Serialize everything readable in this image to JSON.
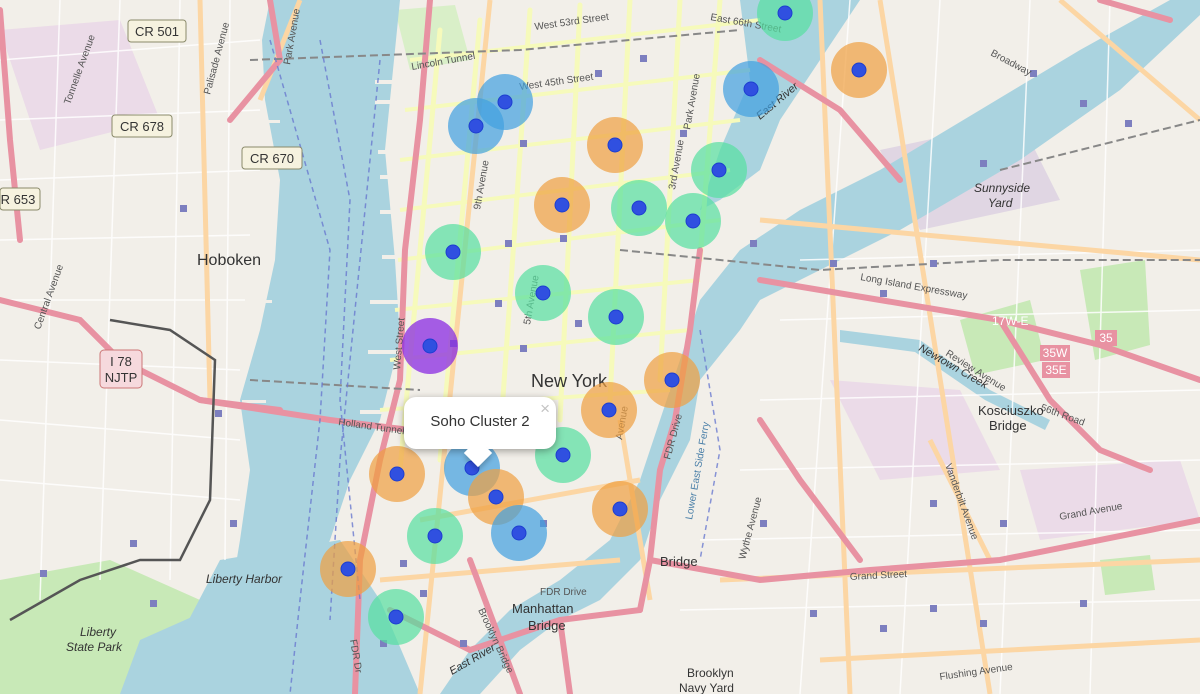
{
  "map": {
    "colors": {
      "land": "#f2efe9",
      "water": "#aad3df",
      "park": "#c8e9b7",
      "major_road": "#e892a2",
      "secondary_road": "#fcd6a4",
      "yellow_road": "#f6fabb",
      "cluster_purple": "#8a2be2",
      "cluster_blue": "#40a0e0",
      "cluster_green": "#56e0a0",
      "cluster_orange": "#f0a040",
      "center_dot": "#3050e0"
    },
    "labels": {
      "hoboken": "Hoboken",
      "new_york": "New York",
      "liberty_state_park": "Liberty\nState Park",
      "sunnyside_yard": "Sunnyside\nYard",
      "kosciuszko_bridge": "Kosciuszko\nBridge",
      "manhattan_bridge": "Manhattan\nBridge",
      "williamsburg_bridge": "Bridge",
      "brooklyn_navy_yard": "Brooklyn\nNavy Yard",
      "liberty_harbor": "Liberty Harbor",
      "east_river": "East River",
      "newtown_creek": "Newtown Creek"
    },
    "shields": {
      "cr501": "CR 501",
      "cr678": "CR 678",
      "cr670": "CR 670",
      "cr653": "R 653",
      "i78": "I 78\nNJTP",
      "r35w": "35W",
      "r35e": "35E",
      "r35": "35",
      "r17we": "17W-E"
    },
    "streets": {
      "broadway": "Broadway",
      "w53": "West 53rd Street",
      "w45": "West 45th Street",
      "e66": "East 66th Street",
      "lincoln": "Lincoln Tunnel",
      "holland": "Holland Tunnel",
      "lie": "Long Island Expressway",
      "fdr": "FDR Drive",
      "grand_ave": "Grand Avenue",
      "grand_st": "Grand Street",
      "flushing": "Flushing Avenue",
      "wythe": "Wythe Avenue",
      "vanderbilt": "Vanderbilt Avenue",
      "review": "Review Avenue",
      "e56": "56th Road",
      "palisade": "Palisade Avenue",
      "tonnelle": "Tonnelle Avenue",
      "central": "Central Avenue",
      "park_ave_nj": "Park Avenue",
      "third_ave": "3rd Avenue",
      "fifth_ave": "5th Avenue",
      "ninth_ave": "9th Avenue",
      "west_st": "West Street",
      "ninth_ave2": "Avenue",
      "park_ave": "Park Avenue",
      "lower_east_side": "Lower East Side Ferry",
      "brooklyn_bridge": "Brooklyn Bridge",
      "fdr_dr": "FDR Dr"
    },
    "clusters": [
      {
        "id": "c1",
        "color": "green"
      },
      {
        "id": "c2",
        "color": "orange"
      },
      {
        "id": "c3",
        "color": "blue"
      },
      {
        "id": "c4",
        "color": "blue"
      },
      {
        "id": "c5",
        "color": "blue"
      },
      {
        "id": "c6",
        "color": "orange"
      },
      {
        "id": "c7",
        "color": "green"
      },
      {
        "id": "c8",
        "color": "orange"
      },
      {
        "id": "c9",
        "color": "green"
      },
      {
        "id": "c10",
        "color": "green"
      },
      {
        "id": "c11",
        "color": "green"
      },
      {
        "id": "c12",
        "color": "green"
      },
      {
        "id": "c13",
        "color": "green"
      },
      {
        "id": "c14",
        "color": "purple"
      },
      {
        "id": "c15",
        "color": "orange"
      },
      {
        "id": "c16",
        "color": "orange"
      },
      {
        "id": "c17",
        "color": "green"
      },
      {
        "id": "c18",
        "color": "orange"
      },
      {
        "id": "c19",
        "color": "blue"
      },
      {
        "id": "c20",
        "color": "orange"
      },
      {
        "id": "c21",
        "color": "orange"
      },
      {
        "id": "c22",
        "color": "green"
      },
      {
        "id": "c23",
        "color": "blue"
      },
      {
        "id": "c24",
        "color": "orange"
      },
      {
        "id": "c25",
        "color": "green"
      }
    ]
  },
  "popup": {
    "text": "Soho Cluster 2",
    "close": "×"
  }
}
